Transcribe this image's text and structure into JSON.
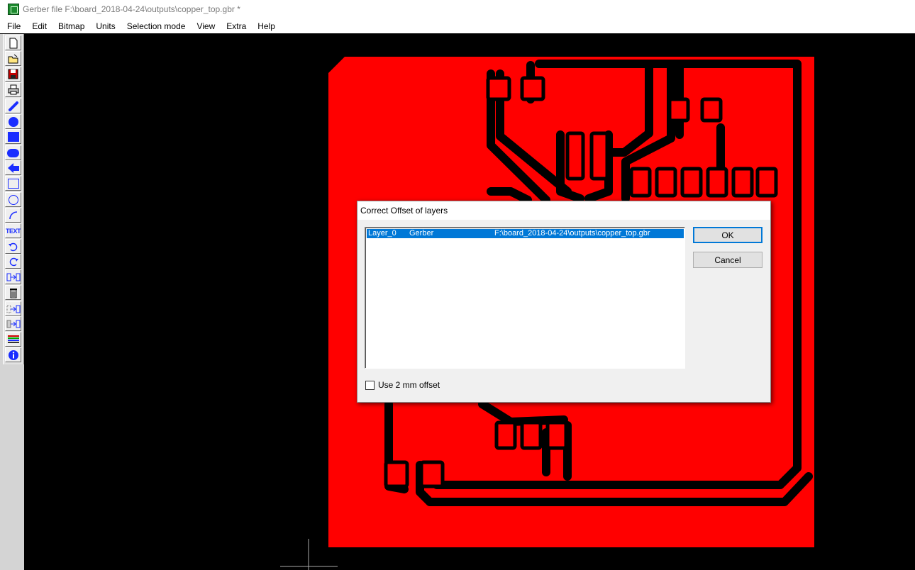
{
  "window": {
    "title": "Gerber file F:\\board_2018-04-24\\outputs\\copper_top.gbr *"
  },
  "menu": [
    "File",
    "Edit",
    "Bitmap",
    "Units",
    "Selection mode",
    "View",
    "Extra",
    "Help"
  ],
  "toolbar": {
    "tools": [
      {
        "name": "new-file-icon",
        "glyph": "page"
      },
      {
        "name": "open-folder-icon",
        "glyph": "folder"
      },
      {
        "name": "save-icon",
        "glyph": "disk"
      },
      {
        "name": "print-icon",
        "glyph": "printer"
      },
      {
        "name": "draw-line-icon",
        "glyph": "line"
      },
      {
        "name": "draw-filled-circle-icon",
        "glyph": "fcircle"
      },
      {
        "name": "draw-filled-rect-icon",
        "glyph": "frect"
      },
      {
        "name": "draw-rounded-rect-icon",
        "glyph": "frounded"
      },
      {
        "name": "draw-polygon-icon",
        "glyph": "arrow"
      },
      {
        "name": "draw-rect-outline-icon",
        "glyph": "rect"
      },
      {
        "name": "draw-circle-outline-icon",
        "glyph": "circle"
      },
      {
        "name": "draw-arc-icon",
        "glyph": "arc"
      },
      {
        "name": "text-tool-icon",
        "glyph": "text",
        "label": "TEXT"
      },
      {
        "name": "undo-icon",
        "glyph": "undo"
      },
      {
        "name": "redo-icon",
        "glyph": "redo"
      },
      {
        "name": "move-icon",
        "glyph": "move"
      },
      {
        "name": "delete-icon",
        "glyph": "trash"
      },
      {
        "name": "copy-move-icon",
        "glyph": "move2"
      },
      {
        "name": "mirror-move-icon",
        "glyph": "move3"
      },
      {
        "name": "layers-icon",
        "glyph": "layers"
      },
      {
        "name": "info-icon",
        "glyph": "info"
      }
    ]
  },
  "colors": {
    "copper": "#ff0000",
    "background": "#000000",
    "tool_blue": "#1a2dff",
    "selection": "#0078d7"
  },
  "dialog": {
    "title": "Correct Offset of layers",
    "layers": [
      {
        "name": "Layer_0",
        "type": "Gerber",
        "path": "F:\\board_2018-04-24\\outputs\\copper_top.gbr",
        "selected": true
      }
    ],
    "ok_label": "OK",
    "cancel_label": "Cancel",
    "checkbox_label": "Use 2 mm offset",
    "checkbox_checked": false
  }
}
